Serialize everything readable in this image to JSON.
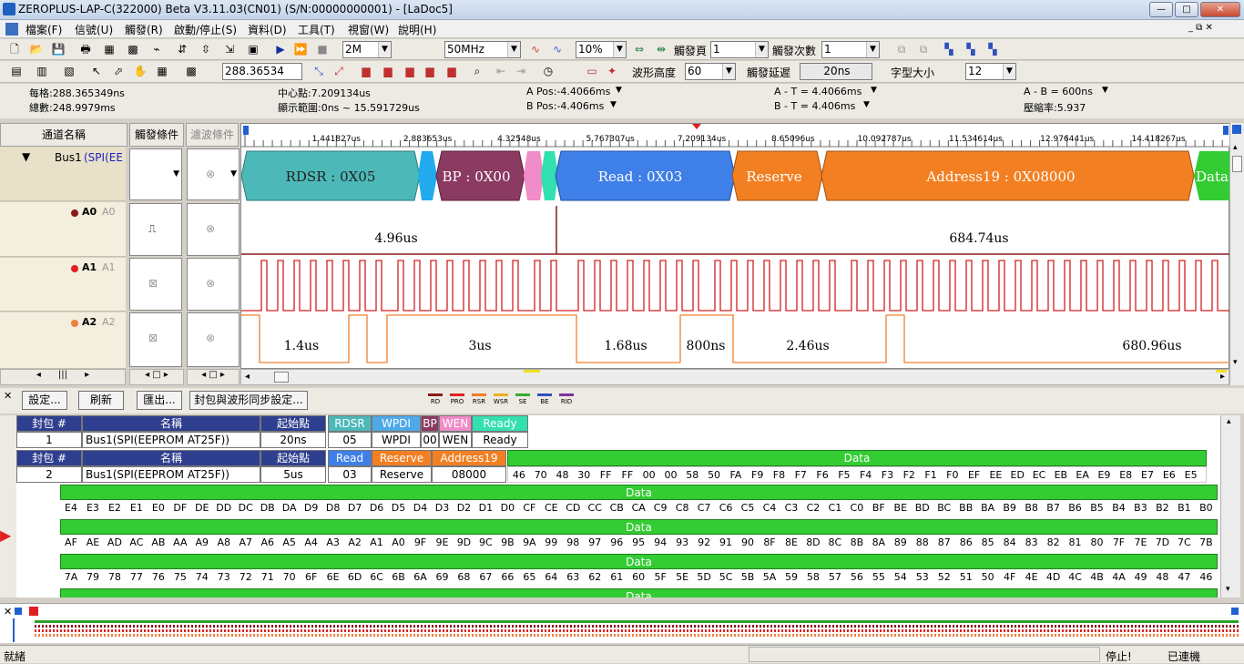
{
  "title": "ZEROPLUS-LAP-C(322000) Beta V3.11.03(CN01) (S/N:00000000001) - [LaDoc5]",
  "menu": [
    "檔案(F)",
    "信號(U)",
    "觸發(R)",
    "啟動/停止(S)",
    "資料(D)",
    "工具(T)",
    "視窗(W)",
    "說明(H)"
  ],
  "toolbar1": {
    "memory": "2M",
    "freq": "50MHz",
    "zoom": "10%",
    "trigger_page_label": "觸發頁",
    "trigger_page": "1",
    "trigger_count_label": "觸發次數",
    "trigger_count": "1"
  },
  "toolbar2": {
    "time_value": "288.36534",
    "wave_height_label": "波形高度",
    "wave_height": "60",
    "trigger_delay_label": "觸發延遲",
    "trigger_delay": "20ns",
    "font_size_label": "字型大小",
    "font_size": "12"
  },
  "info": {
    "grid": "每格:288.365349ns",
    "total": "總數:248.9979ms",
    "center": "中心點:7.209134us",
    "range": "顯示範圍:0ns ~ 15.591729us",
    "a_pos": "A Pos:-4.4066ms",
    "b_pos": "B Pos:-4.406ms",
    "a_t": "A - T = 4.4066ms",
    "b_t": "B - T = 4.406ms",
    "a_b": "A - B = 600ns",
    "compress": "壓縮率:5.937"
  },
  "headers": {
    "channel_name": "通道名稱",
    "trigger_cond": "觸發條件",
    "filter_cond": "濾波條件"
  },
  "channels": [
    {
      "name": "Bus1",
      "sub": "(SPI(EEPR",
      "color": "#000000"
    },
    {
      "name": "A0",
      "sub": "A0",
      "color": "#8b1a1a"
    },
    {
      "name": "A1",
      "sub": "A1",
      "color": "#e02020"
    },
    {
      "name": "A2",
      "sub": "A2",
      "color": "#f08040"
    }
  ],
  "ruler": [
    "1.441827us",
    "2.883653us",
    "4.32548us",
    "5.767307us",
    "7.209134us",
    "8.65096us",
    "10.092787us",
    "11.534614us",
    "12.976441us",
    "14.418267us"
  ],
  "bus_segments": [
    {
      "label": "RDSR : 0X05",
      "color": "#4db8b8"
    },
    {
      "label": "BP : 0X00",
      "color": "#8b3a62"
    },
    {
      "label": "Read : 0X03",
      "color": "#3f7fe8"
    },
    {
      "label": "Reserve",
      "color": "#f28022"
    },
    {
      "label": "Address19 : 0X08000",
      "color": "#f28022"
    },
    {
      "label": "Data",
      "color": "#33cc33"
    }
  ],
  "a0_labels": [
    "4.96us",
    "684.74us"
  ],
  "a2_labels": [
    "1.4us",
    "3us",
    "1.68us",
    "800ns",
    "2.46us",
    "680.96us"
  ],
  "packet_toolbar": {
    "settings": "設定...",
    "refresh": "刷新",
    "export": "匯出...",
    "sync": "封包與波形同步設定..."
  },
  "legend": [
    {
      "label": "RD",
      "color": "#8b1a1a"
    },
    {
      "label": "PRO",
      "color": "#e02020"
    },
    {
      "label": "RSR",
      "color": "#f28022"
    },
    {
      "label": "WSR",
      "color": "#e8b020"
    },
    {
      "label": "SE",
      "color": "#33aa33"
    },
    {
      "label": "BE",
      "color": "#3050c0"
    },
    {
      "label": "RID",
      "color": "#8030a0"
    }
  ],
  "packet_headers": {
    "num": "封包 #",
    "name": "名稱",
    "start": "起始點"
  },
  "packet1": {
    "num": "1",
    "name": "Bus1(SPI(EEPROM AT25F))",
    "start": "20ns",
    "fields": [
      {
        "h": "RDSR",
        "v": "05",
        "c": "#4db8b8"
      },
      {
        "h": "WPDI",
        "v": "WPDI",
        "c": "#4fa8e8"
      },
      {
        "h": "BP",
        "v": "00",
        "c": "#8b3a62"
      },
      {
        "h": "WEN",
        "v": "WEN",
        "c": "#f08cc8"
      },
      {
        "h": "Ready",
        "v": "Ready",
        "c": "#33e0b0"
      }
    ]
  },
  "packet2": {
    "num": "2",
    "name": "Bus1(SPI(EEPROM AT25F))",
    "start": "5us",
    "fields": [
      {
        "h": "Read",
        "v": "03",
        "c": "#3f7fe8"
      },
      {
        "h": "Reserve",
        "v": "Reserve",
        "c": "#f28022"
      },
      {
        "h": "Address19",
        "v": "08000",
        "c": "#f28022"
      }
    ],
    "data_head": "Data",
    "data": "46 70 48 30 FF FF 00 00 58 50 FA F9 F8 F7 F6 F5 F4 F3 F2 F1 F0 EF EE ED EC EB EA E9 E8 E7 E6 E5"
  },
  "data_rows": [
    {
      "head": "Data",
      "values": "E4 E3 E2 E1 E0 DF DE DD DC DB DA D9 D8 D7 D6 D5 D4 D3 D2 D1 D0 CF CE CD CC CB CA C9 C8 C7 C6 C5 C4 C3 C2 C1 C0 BF BE BD BC BB BA B9 B8 B7 B6 B5 B4 B3 B2 B1 B0"
    },
    {
      "head": "Data",
      "values": "AF AE AD AC AB AA A9 A8 A7 A6 A5 A4 A3 A2 A1 A0 9F 9E 9D 9C 9B 9A 99 98 97 96 95 94 93 92 91 90 8F 8E 8D 8C 8B 8A 89 88 87 86 85 84 83 82 81 80 7F 7E 7D 7C 7B"
    },
    {
      "head": "Data",
      "values": "7A 79 78 77 76 75 74 73 72 71 70 6F 6E 6D 6C 6B 6A 69 68 67 66 65 64 63 62 61 60 5F 5E 5D 5C 5B 5A 59 58 57 56 55 54 53 52 51 50 4F 4E 4D 4C 4B 4A 49 48 47 46"
    },
    {
      "head": "Data",
      "values": ""
    }
  ],
  "status": {
    "left": "就緒",
    "stopped": "停止!",
    "connected": "已連機"
  }
}
